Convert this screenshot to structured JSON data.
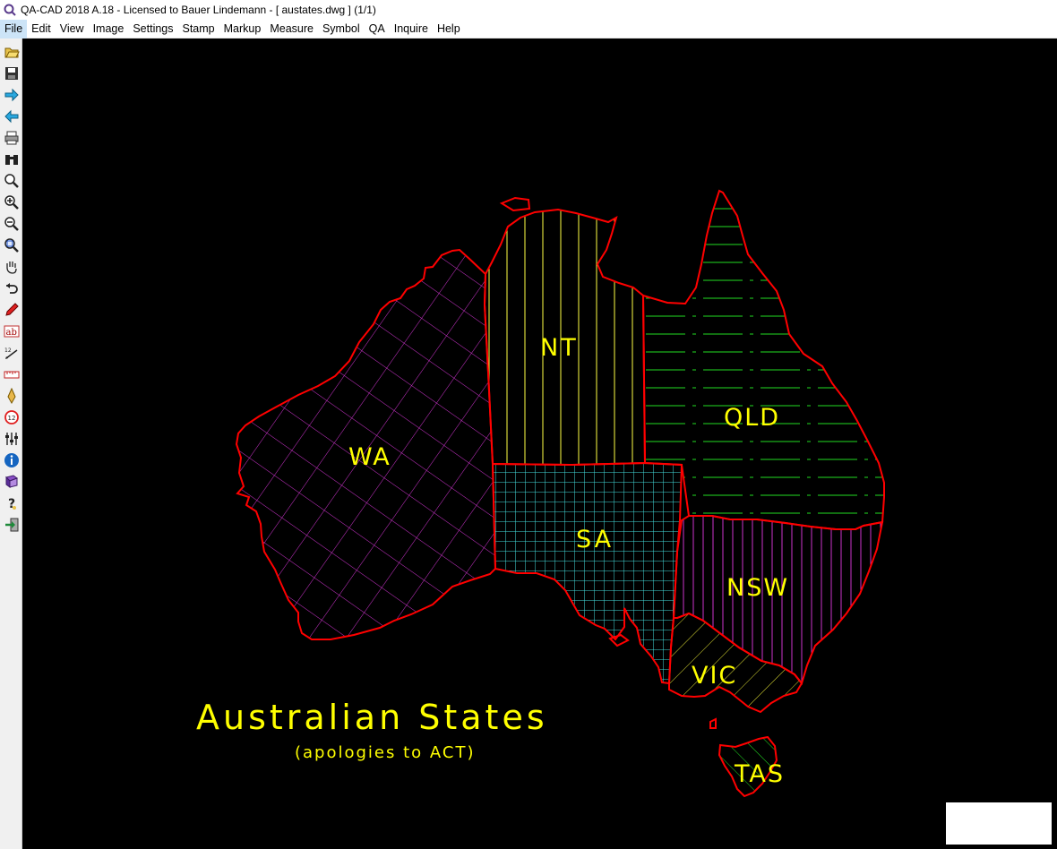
{
  "window": {
    "title": "QA-CAD 2018 A.18 - Licensed to Bauer Lindemann  -  [ austates.dwg ] (1/1)",
    "app_icon": "qa-cad-app-icon"
  },
  "menu": [
    "File",
    "Edit",
    "View",
    "Image",
    "Settings",
    "Stamp",
    "Markup",
    "Measure",
    "Symbol",
    "QA",
    "Inquire",
    "Help"
  ],
  "toolbar": [
    "open-folder-icon",
    "save-icon",
    "next-arrow-icon",
    "previous-arrow-icon",
    "print-icon",
    "binoculars-icon",
    "zoom-icon",
    "zoom-in-icon",
    "zoom-out-icon",
    "zoom-window-icon",
    "pan-hand-icon",
    "undo-icon",
    "pencil-icon",
    "text-ab-icon",
    "dimension-icon",
    "ruler-icon",
    "pen-tip-icon",
    "balloon-number-icon",
    "layers-icon",
    "info-icon",
    "book-icon",
    "help-question-icon",
    "exit-icon"
  ],
  "drawing": {
    "title": "Australian States",
    "subtitle": "(apologies to ACT)",
    "states": [
      "WA",
      "NT",
      "SA",
      "QLD",
      "NSW",
      "VIC",
      "TAS"
    ],
    "colors": {
      "outline": "#ff0000",
      "label": "#ffff00",
      "wa_hatch": "#cc33cc",
      "nt_hatch": "#ffff44",
      "sa_hatch": "#44dddd",
      "qld_hatch": "#22dd22",
      "nsw_hatch": "#cc33cc",
      "vic_hatch": "#dddd33",
      "tas_hatch": "#22dd22",
      "background": "#000000"
    }
  }
}
